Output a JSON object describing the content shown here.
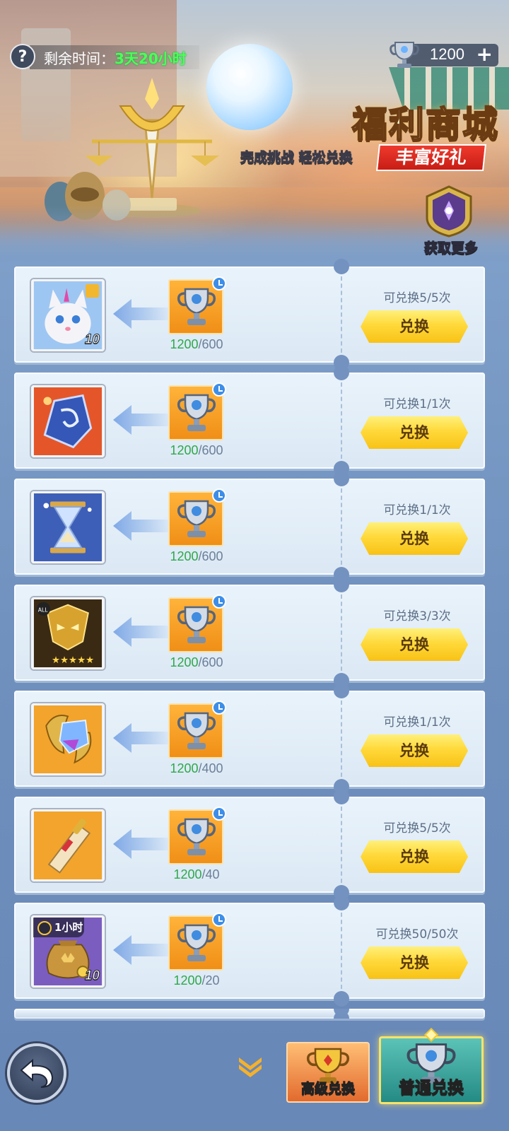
{
  "header": {
    "help_symbol": "?",
    "timer_label": "剩余时间：",
    "timer_value": "3天20小时",
    "currency_amount": "1200",
    "currency_plus": "+",
    "shop_title": "福利商城",
    "shop_subtitle": "完成挑战 轻松兑换",
    "shop_tag": "丰富好礼",
    "get_more_label": "获取更多"
  },
  "items": [
    {
      "icon": "white-cat-pet-icon",
      "qty": "10",
      "have": "1200",
      "cost": "600",
      "limit": "可兑换5/5次",
      "button": "兑换"
    },
    {
      "icon": "blue-crystal-icon",
      "qty": "",
      "have": "1200",
      "cost": "600",
      "limit": "可兑换1/1次",
      "button": "兑换"
    },
    {
      "icon": "hourglass-icon",
      "qty": "",
      "have": "1200",
      "cost": "600",
      "limit": "可兑换1/1次",
      "button": "兑换"
    },
    {
      "icon": "golden-mask-icon",
      "qty": "",
      "badge": "ALL",
      "have": "1200",
      "cost": "600",
      "limit": "可兑换3/3次",
      "button": "兑换"
    },
    {
      "icon": "gem-emblem-icon",
      "qty": "",
      "have": "1200",
      "cost": "400",
      "limit": "可兑换1/1次",
      "button": "兑换"
    },
    {
      "icon": "scroll-icon",
      "qty": "",
      "have": "1200",
      "cost": "40",
      "limit": "可兑换5/5次",
      "button": "兑换"
    },
    {
      "icon": "coin-bag-icon",
      "qty": "10",
      "time_tag": "1小时",
      "have": "1200",
      "cost": "20",
      "limit": "可兑换50/50次",
      "button": "兑换"
    }
  ],
  "tabs": {
    "premium_label": "高级兑换",
    "normal_label": "普通兑换",
    "active": "normal"
  },
  "colors": {
    "have_green": "#2ea84a",
    "button_yellow": "#ffd93a",
    "tag_red": "#e02a20",
    "timer_green": "#4cff58"
  }
}
